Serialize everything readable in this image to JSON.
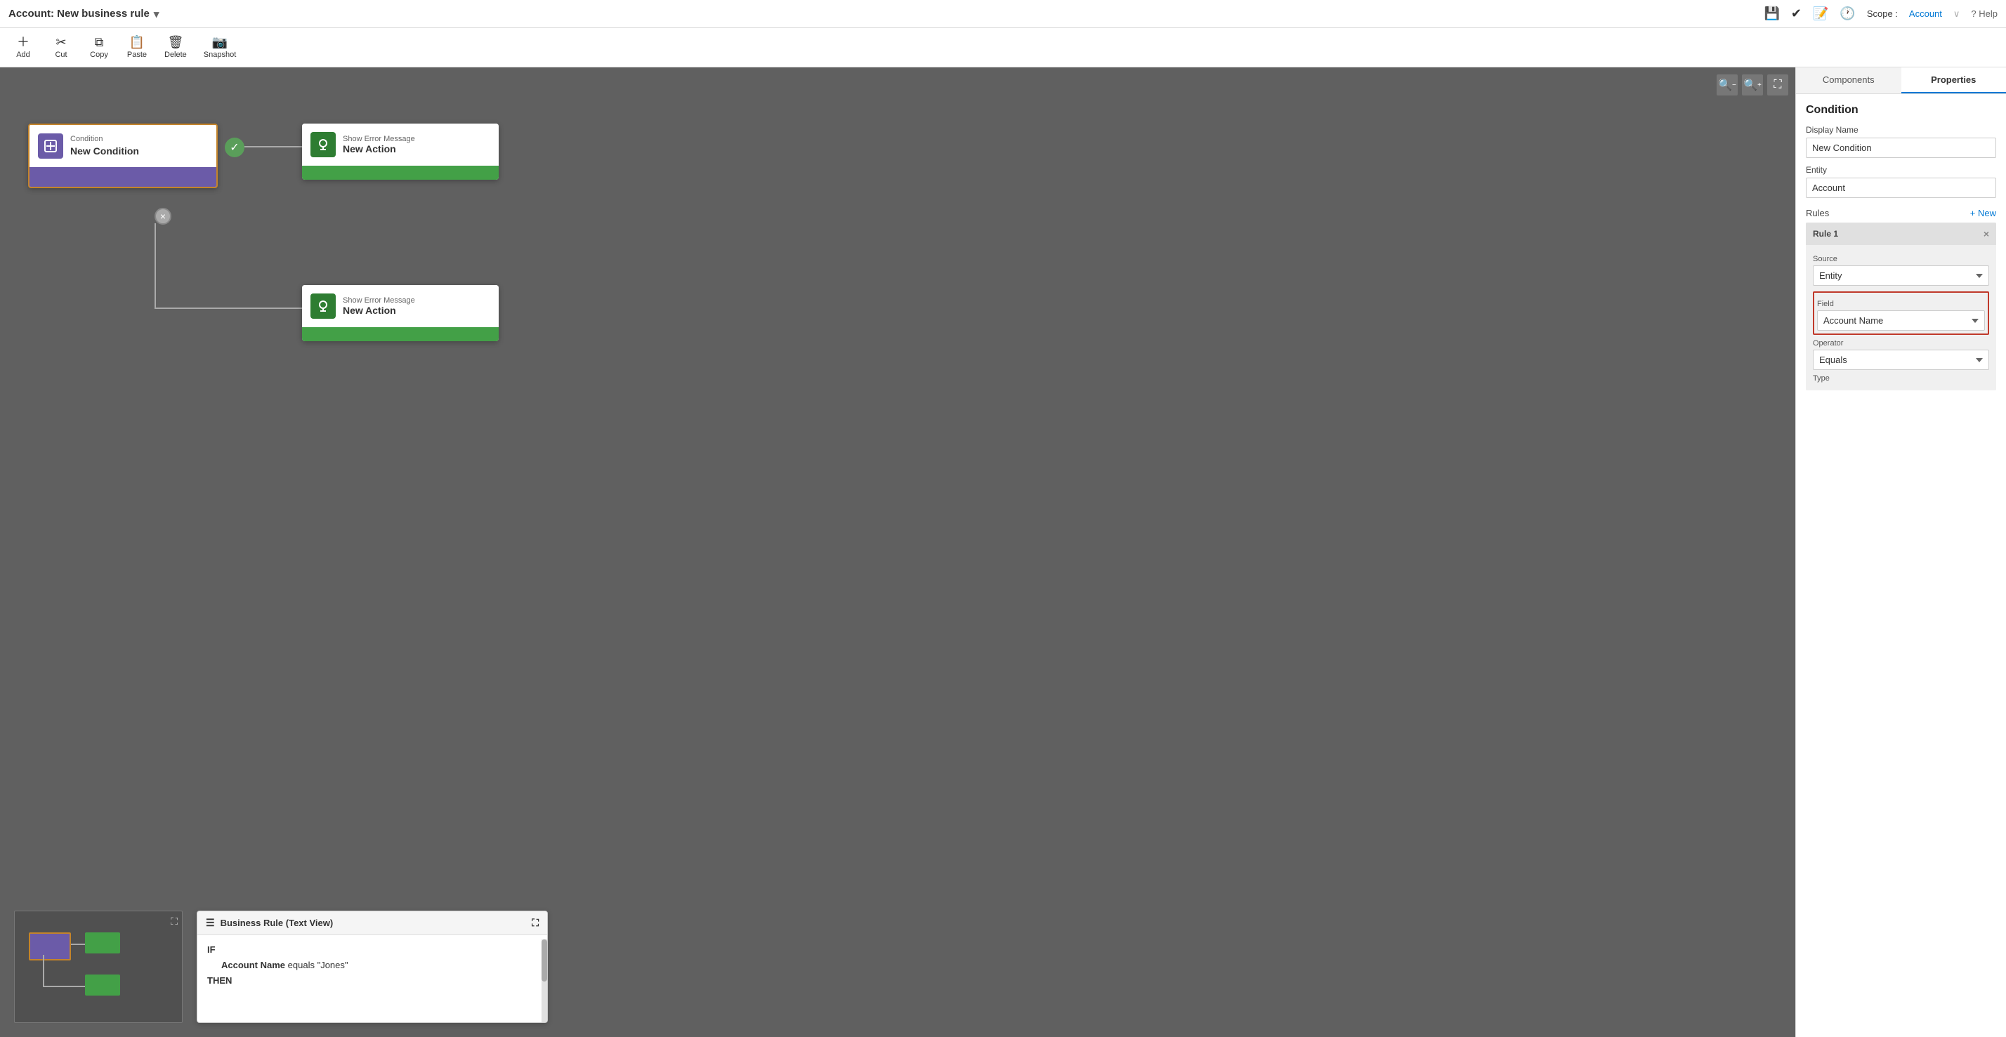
{
  "titleBar": {
    "title": "Account: New business rule",
    "chevron": "▾",
    "rightIcons": [
      "💾",
      "📋",
      "📄",
      "🕐"
    ],
    "scopeLabel": "Scope :",
    "scopeValue": "Account",
    "helpLabel": "? Help"
  },
  "toolbar": {
    "buttons": [
      {
        "label": "Add",
        "icon": "+",
        "name": "add-button"
      },
      {
        "label": "Cut",
        "icon": "✂",
        "name": "cut-button"
      },
      {
        "label": "Copy",
        "icon": "⧉",
        "name": "copy-button"
      },
      {
        "label": "Paste",
        "icon": "📋",
        "name": "paste-button"
      },
      {
        "label": "Delete",
        "icon": "🗑",
        "name": "delete-button"
      },
      {
        "label": "Snapshot",
        "icon": "📷",
        "name": "snapshot-button"
      }
    ]
  },
  "canvas": {
    "conditionNode": {
      "type": "Condition",
      "name": "New Condition"
    },
    "actionNode1": {
      "type": "Show Error Message",
      "name": "New Action"
    },
    "actionNode2": {
      "type": "Show Error Message",
      "name": "New Action"
    },
    "textView": {
      "title": "Business Rule (Text View)",
      "if_label": "IF",
      "then_label": "THEN",
      "condition_text": "Account Name equals \"Jones\"",
      "then_text": "..."
    }
  },
  "rightPanel": {
    "tabs": [
      {
        "label": "Components",
        "active": false
      },
      {
        "label": "Properties",
        "active": true
      }
    ],
    "properties": {
      "sectionTitle": "Condition",
      "displayNameLabel": "Display Name",
      "displayNameValue": "New Condition",
      "entityLabel": "Entity",
      "entityValue": "Account",
      "rulesLabel": "Rules",
      "rulesNewLabel": "+ New",
      "rule1": {
        "label": "Rule 1",
        "sourceLabel": "Source",
        "sourceValue": "Entity",
        "fieldLabel": "Field",
        "fieldValue": "Account Name",
        "operatorLabel": "Operator",
        "operatorValue": "Equals",
        "typeLabel": "Type"
      }
    }
  }
}
